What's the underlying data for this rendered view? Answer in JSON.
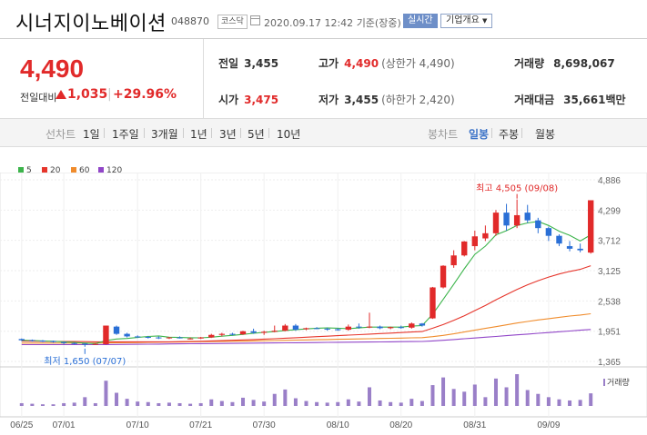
{
  "header": {
    "company": "시너지이노베이션",
    "code": "048870",
    "market": "코스닥",
    "datetime": "2020.09.17 12:42",
    "basis": "기준(장중)",
    "realtime": "실시간",
    "company_info": "기업개요"
  },
  "summary": {
    "price": "4,490",
    "change_label": "전일대비",
    "change": "1,035",
    "change_pct": "+29.96%",
    "prev_close_label": "전일",
    "prev_close": "3,455",
    "open_label": "시가",
    "open": "3,475",
    "high_label": "고가",
    "high": "4,490",
    "upper_limit": "(상한가 4,490)",
    "low_label": "저가",
    "low": "3,455",
    "lower_limit": "(하한가 2,420)",
    "volume_label": "거래량",
    "volume": "8,698,067",
    "amount_label": "거래대금",
    "amount": "35,661",
    "amount_unit": "백만"
  },
  "tabs": {
    "line_label": "선차트",
    "line_items": [
      "1일",
      "1주일",
      "3개월",
      "1년",
      "3년",
      "5년",
      "10년"
    ],
    "candle_label": "봉차트",
    "candle_items": [
      "일봉",
      "주봉",
      "월봉"
    ],
    "candle_selected": "일봉"
  },
  "legend": [
    {
      "label": "5",
      "color": "#3cb44b"
    },
    {
      "label": "20",
      "color": "#e6352b"
    },
    {
      "label": "60",
      "color": "#f08c2c"
    },
    {
      "label": "120",
      "color": "#9146c8"
    }
  ],
  "volume_legend": "거래량",
  "chart_data": {
    "type": "candlestick",
    "y_ticks": [
      "4,886",
      "4,299",
      "3,712",
      "3,125",
      "2,538",
      "1,951",
      "1,365"
    ],
    "ylim": [
      1365,
      4886
    ],
    "x_ticks": [
      "06/25",
      "07/01",
      "07/10",
      "07/21",
      "07/30",
      "08/10",
      "08/20",
      "08/31",
      "09/09"
    ],
    "x_tick_index": [
      0,
      4,
      11,
      17,
      23,
      30,
      36,
      43,
      50
    ],
    "max_annotation": "최고 4,505 (09/08)",
    "min_annotation": "최저 1,650 (07/07)",
    "candles": [
      [
        1800,
        1810,
        1760,
        1775
      ],
      [
        1780,
        1790,
        1750,
        1765
      ],
      [
        1770,
        1780,
        1740,
        1750
      ],
      [
        1760,
        1770,
        1730,
        1740
      ],
      [
        1740,
        1750,
        1700,
        1720
      ],
      [
        1720,
        1735,
        1695,
        1710
      ],
      [
        1710,
        1720,
        1650,
        1690
      ],
      [
        1700,
        1720,
        1690,
        1705
      ],
      [
        1700,
        2060,
        1690,
        2060
      ],
      [
        2040,
        2060,
        1880,
        1900
      ],
      [
        1900,
        1920,
        1830,
        1850
      ],
      [
        1850,
        1870,
        1820,
        1840
      ],
      [
        1840,
        1860,
        1810,
        1830
      ],
      [
        1830,
        1850,
        1800,
        1820
      ],
      [
        1820,
        1840,
        1800,
        1830
      ],
      [
        1830,
        1850,
        1810,
        1820
      ],
      [
        1810,
        1830,
        1790,
        1810
      ],
      [
        1810,
        1840,
        1800,
        1830
      ],
      [
        1830,
        1900,
        1820,
        1880
      ],
      [
        1880,
        1920,
        1850,
        1900
      ],
      [
        1900,
        1920,
        1870,
        1890
      ],
      [
        1890,
        1960,
        1880,
        1950
      ],
      [
        1950,
        2000,
        1900,
        1920
      ],
      [
        1920,
        1960,
        1880,
        1940
      ],
      [
        1940,
        2060,
        1930,
        1960
      ],
      [
        1960,
        2090,
        1950,
        2060
      ],
      [
        2060,
        2090,
        1960,
        1980
      ],
      [
        1990,
        2020,
        1970,
        2010
      ],
      [
        2010,
        2030,
        1990,
        2000
      ],
      [
        2000,
        2020,
        1960,
        1990
      ],
      [
        1990,
        2010,
        1960,
        1970
      ],
      [
        1980,
        2080,
        1960,
        2040
      ],
      [
        2040,
        2100,
        2000,
        2030
      ],
      [
        2030,
        2310,
        2010,
        2040
      ],
      [
        2040,
        2060,
        1990,
        2010
      ],
      [
        2010,
        2040,
        1990,
        2030
      ],
      [
        2030,
        2060,
        2000,
        2020
      ],
      [
        2020,
        2120,
        2000,
        2100
      ],
      [
        2100,
        2110,
        2040,
        2060
      ],
      [
        2200,
        2810,
        2190,
        2800
      ],
      [
        2800,
        3230,
        2780,
        3220
      ],
      [
        3230,
        3520,
        3180,
        3420
      ],
      [
        3420,
        3700,
        3400,
        3690
      ],
      [
        3600,
        3900,
        3520,
        3790
      ],
      [
        3750,
        4000,
        3700,
        3850
      ],
      [
        3850,
        4300,
        3800,
        4250
      ],
      [
        4250,
        4420,
        3900,
        4000
      ],
      [
        4000,
        4505,
        3950,
        4200
      ],
      [
        4250,
        4400,
        4050,
        4100
      ],
      [
        4100,
        4150,
        3850,
        3950
      ],
      [
        3950,
        3980,
        3700,
        3800
      ],
      [
        3800,
        3830,
        3600,
        3650
      ],
      [
        3600,
        3700,
        3500,
        3550
      ],
      [
        3550,
        3650,
        3480,
        3520
      ],
      [
        3475,
        4490,
        3455,
        4490
      ]
    ],
    "ma5": [
      1775,
      1770,
      1762,
      1755,
      1745,
      1735,
      1720,
      1710,
      1770,
      1800,
      1810,
      1830,
      1850,
      1860,
      1835,
      1830,
      1825,
      1822,
      1835,
      1855,
      1870,
      1890,
      1910,
      1930,
      1945,
      1965,
      1980,
      1995,
      2010,
      2015,
      2010,
      2000,
      2015,
      2030,
      2030,
      2030,
      2030,
      2050,
      2060,
      2280,
      2570,
      2860,
      3160,
      3440,
      3600,
      3820,
      3900,
      4000,
      4050,
      4080,
      4000,
      3890,
      3810,
      3700,
      3820
    ],
    "ma20": [
      1760,
      1758,
      1756,
      1754,
      1752,
      1750,
      1748,
      1746,
      1745,
      1745,
      1745,
      1745,
      1745,
      1745,
      1745,
      1748,
      1752,
      1756,
      1762,
      1768,
      1775,
      1782,
      1790,
      1798,
      1806,
      1815,
      1825,
      1835,
      1845,
      1855,
      1865,
      1875,
      1885,
      1895,
      1905,
      1915,
      1925,
      1935,
      1945,
      2010,
      2080,
      2160,
      2250,
      2350,
      2450,
      2560,
      2660,
      2760,
      2850,
      2930,
      3000,
      3060,
      3110,
      3150,
      3220
    ],
    "ma60": [
      1720,
      1720,
      1720,
      1720,
      1720,
      1720,
      1720,
      1720,
      1725,
      1728,
      1730,
      1732,
      1735,
      1738,
      1740,
      1742,
      1745,
      1748,
      1750,
      1752,
      1755,
      1758,
      1762,
      1766,
      1770,
      1774,
      1778,
      1782,
      1786,
      1790,
      1794,
      1798,
      1802,
      1806,
      1810,
      1814,
      1818,
      1822,
      1826,
      1845,
      1870,
      1900,
      1935,
      1970,
      2005,
      2040,
      2075,
      2110,
      2140,
      2170,
      2195,
      2220,
      2245,
      2265,
      2290
    ],
    "ma120": [
      1690,
      1690,
      1690,
      1690,
      1690,
      1690,
      1690,
      1690,
      1692,
      1694,
      1696,
      1698,
      1700,
      1702,
      1704,
      1706,
      1708,
      1710,
      1712,
      1714,
      1716,
      1718,
      1720,
      1722,
      1724,
      1726,
      1728,
      1730,
      1732,
      1734,
      1736,
      1738,
      1740,
      1742,
      1744,
      1746,
      1748,
      1750,
      1752,
      1762,
      1775,
      1790,
      1805,
      1820,
      1835,
      1850,
      1865,
      1880,
      1895,
      1910,
      1925,
      1940,
      1955,
      1970,
      1985
    ],
    "volume": [
      0.5,
      0.4,
      0.3,
      0.3,
      0.5,
      0.6,
      1.6,
      0.5,
      4.6,
      2.4,
      1.3,
      0.8,
      0.7,
      0.5,
      0.6,
      0.5,
      0.4,
      0.5,
      1.2,
      0.9,
      0.7,
      1.5,
      1.1,
      0.8,
      2.2,
      3.0,
      1.4,
      0.9,
      0.7,
      0.6,
      0.7,
      1.2,
      0.8,
      3.4,
      1.0,
      0.7,
      0.6,
      1.3,
      0.9,
      3.8,
      5.2,
      3.1,
      2.6,
      3.9,
      1.6,
      5.0,
      3.4,
      5.8,
      2.9,
      2.2,
      1.6,
      1.2,
      1.0,
      1.1,
      2.3
    ]
  }
}
